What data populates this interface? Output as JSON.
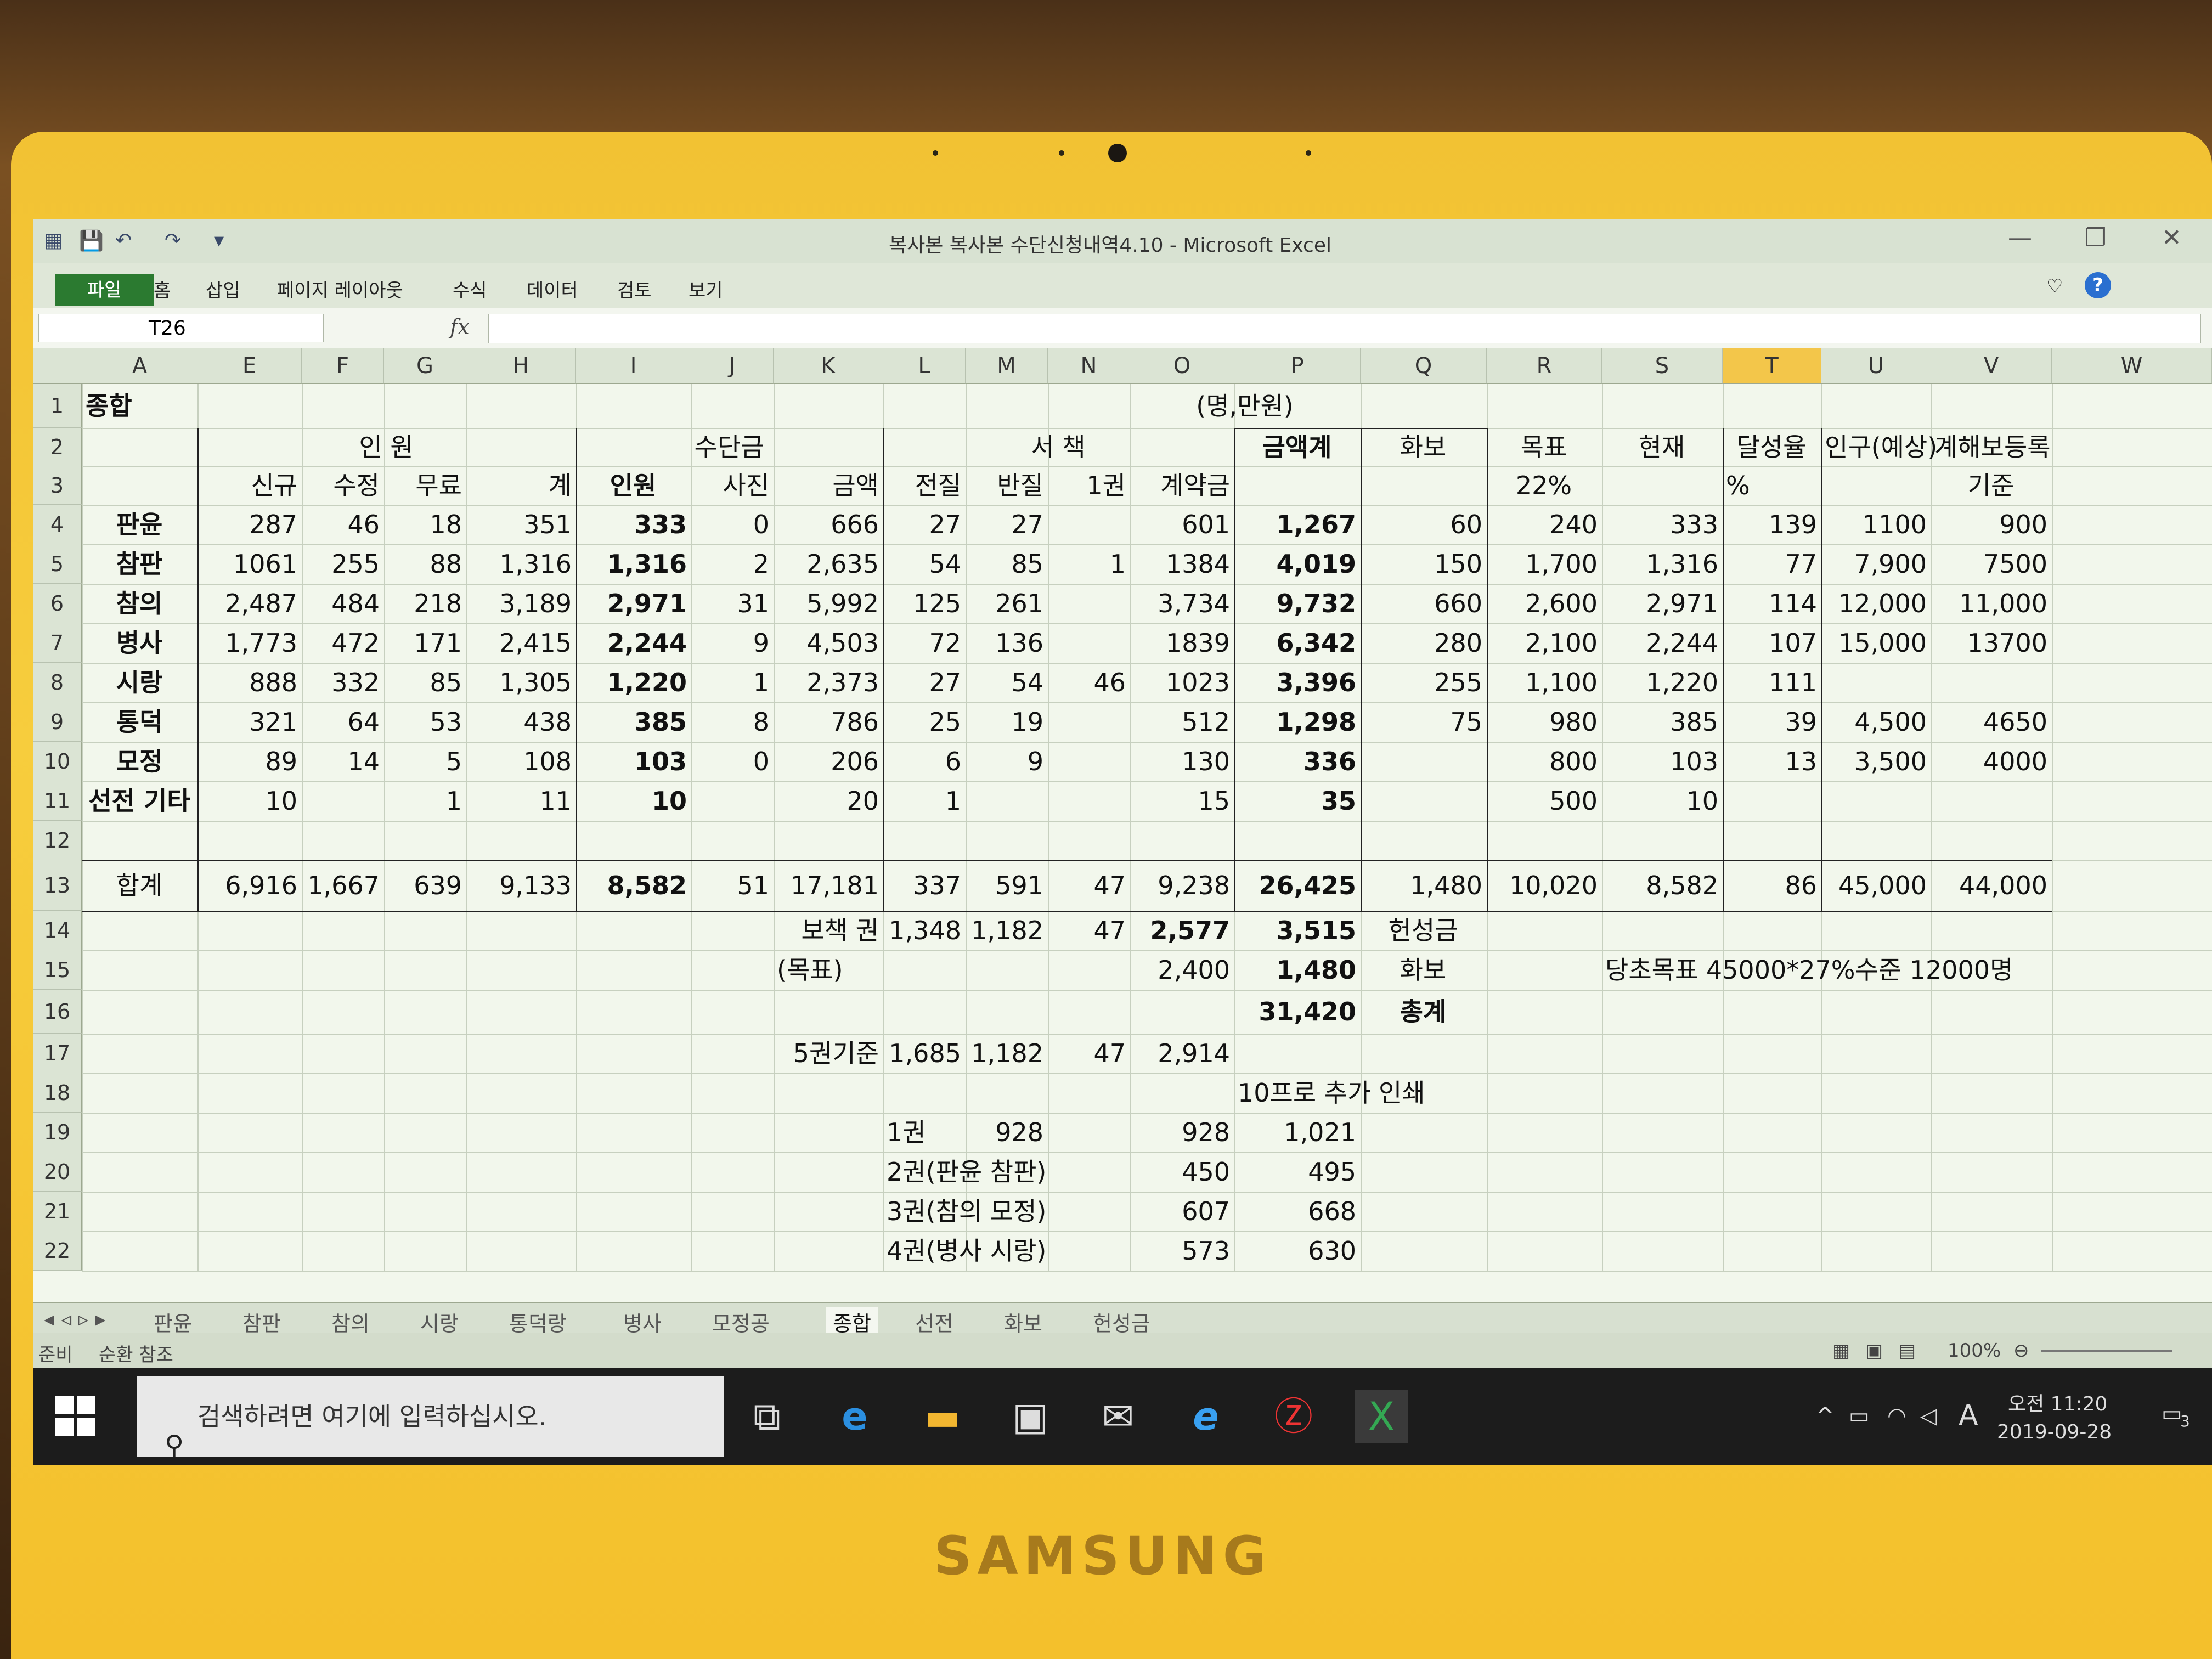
{
  "window": {
    "title": "복사본 복사본 수단신청내역4.10 - Microsoft Excel",
    "minimize": "—",
    "restore": "❐",
    "close": "✕"
  },
  "ribbon": {
    "tabs": [
      "파일",
      "홈",
      "삽입",
      "페이지 레이아웃",
      "수식",
      "데이터",
      "검토",
      "보기"
    ]
  },
  "formula_bar": {
    "name_box": "T26",
    "fx": "fx",
    "content": ""
  },
  "columns": [
    "A",
    "E",
    "F",
    "G",
    "H",
    "I",
    "J",
    "K",
    "L",
    "M",
    "N",
    "O",
    "P",
    "Q",
    "R",
    "S",
    "T",
    "U",
    "V",
    "W"
  ],
  "selected_column": "T",
  "rows": [
    "1",
    "2",
    "3",
    "4",
    "5",
    "6",
    "7",
    "8",
    "9",
    "10",
    "11",
    "12",
    "13",
    "14",
    "15",
    "16",
    "17",
    "18",
    "19",
    "20",
    "21",
    "22"
  ],
  "sheet": {
    "title": "종합",
    "unit": "(명,만원)",
    "h2": {
      "inwon": "인 원",
      "sudangeum": "수단금",
      "seochaek": "서 책",
      "geumaekgye": "금액계",
      "hwabo": "화보",
      "mokpyo": "목표",
      "hyeonjae": "현재",
      "dalseong": "달성율",
      "ingu": "인구(예상)",
      "gyehae": "계해보등록"
    },
    "h3": {
      "sinkyu": "신규",
      "sujeong": "수정",
      "muryo": "무료",
      "gye": "계",
      "inwon": "인원",
      "sajin": "사진",
      "geumaek": "금액",
      "jeonjil": "전질",
      "banjil": "반질",
      "ilgwon": "1권",
      "gyeyakgeum": "계약금",
      "pct22": "22%",
      "pct": "%",
      "gijun": "기준"
    },
    "data_rows": [
      {
        "name": "판윤",
        "E": "287",
        "F": "46",
        "G": "18",
        "H": "351",
        "I": "333",
        "J": "0",
        "K": "666",
        "L": "27",
        "M": "27",
        "N": "",
        "O": "601",
        "P": "1,267",
        "Q": "60",
        "R": "240",
        "S": "333",
        "T": "139",
        "U": "1100",
        "V": "900"
      },
      {
        "name": "참판",
        "E": "1061",
        "F": "255",
        "G": "88",
        "H": "1,316",
        "I": "1,316",
        "J": "2",
        "K": "2,635",
        "L": "54",
        "M": "85",
        "N": "1",
        "O": "1384",
        "P": "4,019",
        "Q": "150",
        "R": "1,700",
        "S": "1,316",
        "T": "77",
        "U": "7,900",
        "V": "7500"
      },
      {
        "name": "참의",
        "E": "2,487",
        "F": "484",
        "G": "218",
        "H": "3,189",
        "I": "2,971",
        "J": "31",
        "K": "5,992",
        "L": "125",
        "M": "261",
        "N": "",
        "O": "3,734",
        "P": "9,732",
        "Q": "660",
        "R": "2,600",
        "S": "2,971",
        "T": "114",
        "U": "12,000",
        "V": "11,000"
      },
      {
        "name": "병사",
        "E": "1,773",
        "F": "472",
        "G": "171",
        "H": "2,415",
        "I": "2,244",
        "J": "9",
        "K": "4,503",
        "L": "72",
        "M": "136",
        "N": "",
        "O": "1839",
        "P": "6,342",
        "Q": "280",
        "R": "2,100",
        "S": "2,244",
        "T": "107",
        "U": "15,000",
        "V": "13700"
      },
      {
        "name": "시랑",
        "E": "888",
        "F": "332",
        "G": "85",
        "H": "1,305",
        "I": "1,220",
        "J": "1",
        "K": "2,373",
        "L": "27",
        "M": "54",
        "N": "46",
        "O": "1023",
        "P": "3,396",
        "Q": "255",
        "R": "1,100",
        "S": "1,220",
        "T": "111",
        "U": "",
        "V": ""
      },
      {
        "name": "통덕",
        "E": "321",
        "F": "64",
        "G": "53",
        "H": "438",
        "I": "385",
        "J": "8",
        "K": "786",
        "L": "25",
        "M": "19",
        "N": "",
        "O": "512",
        "P": "1,298",
        "Q": "75",
        "R": "980",
        "S": "385",
        "T": "39",
        "U": "4,500",
        "V": "4650"
      },
      {
        "name": "모정",
        "E": "89",
        "F": "14",
        "G": "5",
        "H": "108",
        "I": "103",
        "J": "0",
        "K": "206",
        "L": "6",
        "M": "9",
        "N": "",
        "O": "130",
        "P": "336",
        "Q": "",
        "R": "800",
        "S": "103",
        "T": "13",
        "U": "3,500",
        "V": "4000"
      },
      {
        "name": "선전 기타",
        "E": "10",
        "F": "",
        "G": "1",
        "H": "11",
        "I": "10",
        "J": "",
        "K": "20",
        "L": "1",
        "M": "",
        "N": "",
        "O": "15",
        "P": "35",
        "Q": "",
        "R": "500",
        "S": "10",
        "T": "",
        "U": "",
        "V": ""
      }
    ],
    "total": {
      "name": "합계",
      "E": "6,916",
      "F": "1,667",
      "G": "639",
      "H": "9,133",
      "I": "8,582",
      "J": "51",
      "K": "17,181",
      "L": "337",
      "M": "591",
      "N": "47",
      "O": "9,238",
      "P": "26,425",
      "Q": "1,480",
      "R": "10,020",
      "S": "8,582",
      "T": "86",
      "U": "45,000",
      "V": "44,000"
    },
    "r14": {
      "label": "보책 권",
      "L": "1,348",
      "M": "1,182",
      "N": "47",
      "O": "2,577",
      "P": "3,515",
      "Q": "헌성금"
    },
    "r15": {
      "label": "(목표)",
      "O": "2,400",
      "P": "1,480",
      "Q": "화보",
      "note": "당초목표 45000*27%수준 12000명"
    },
    "r16": {
      "P": "31,420",
      "Q": "총계"
    },
    "r17": {
      "label": "5권기준",
      "L": "1,685",
      "M": "1,182",
      "N": "47",
      "O": "2,914"
    },
    "r18": {
      "note": "10프로 추가 인쇄"
    },
    "r19": {
      "label": "1권",
      "M": "928",
      "O": "928",
      "P": "1,021"
    },
    "r20": {
      "label": "2권(판윤 참판)",
      "O": "450",
      "P": "495"
    },
    "r21": {
      "label": "3권(참의 모정)",
      "O": "607",
      "P": "668"
    },
    "r22": {
      "label": "4권(병사 시랑)",
      "O": "573",
      "P": "630"
    }
  },
  "sheet_tabs": [
    "판윤",
    "참판",
    "참의",
    "시랑",
    "통덕랑",
    "병사",
    "모정공",
    "종합",
    "선전",
    "화보",
    "헌성금"
  ],
  "active_sheet": "종합",
  "status": {
    "ready": "준비",
    "circular": "순환 참조",
    "zoom": "100%"
  },
  "taskbar": {
    "search_placeholder": "검색하려면 여기에 입력하십시오.",
    "time": "오전 11:20",
    "date": "2019-09-28",
    "ime": "A",
    "notif_count": "3"
  },
  "brand": "SAMSUNG"
}
